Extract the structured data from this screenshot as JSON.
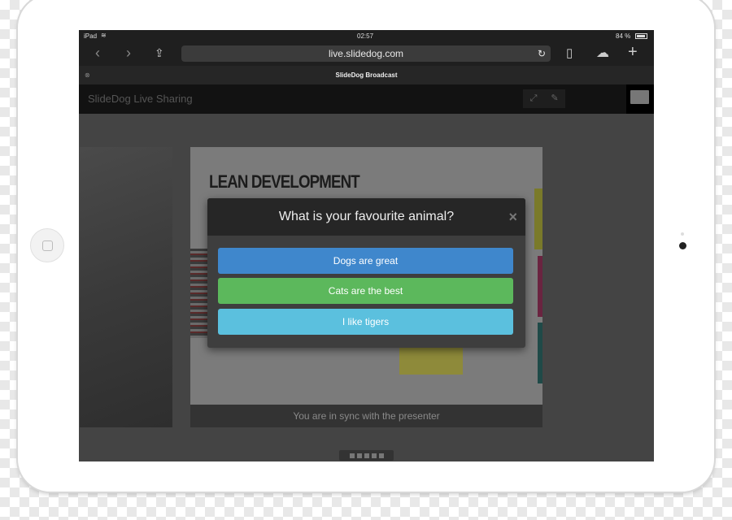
{
  "status_bar": {
    "device": "iPad",
    "time": "02:57",
    "battery": "84 %"
  },
  "browser": {
    "url": "live.slidedog.com",
    "tab_title": "SlideDog Broadcast"
  },
  "app": {
    "title": "SlideDog Live Sharing"
  },
  "slide": {
    "title": "LEAN DEVELOPMENT",
    "sync_text": "You are in sync with the presenter"
  },
  "poll": {
    "question": "What is your favourite animal?",
    "close": "×",
    "options": [
      {
        "label": "Dogs are great",
        "color": "#3f87cc"
      },
      {
        "label": "Cats are the best",
        "color": "#5cb85c"
      },
      {
        "label": "I like tigers",
        "color": "#5bc0de"
      }
    ]
  },
  "pager": {
    "pages": 5
  }
}
